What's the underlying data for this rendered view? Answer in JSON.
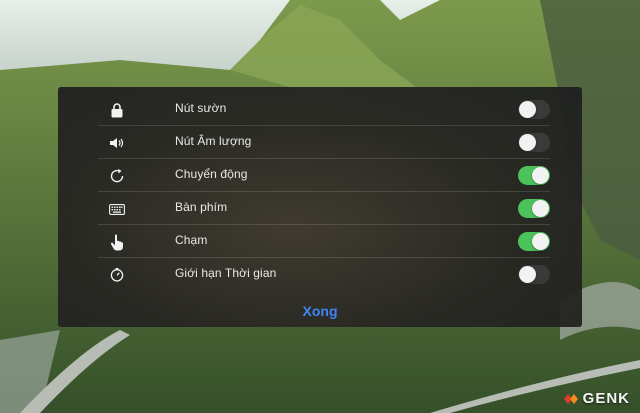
{
  "settings": {
    "items": [
      {
        "label": "Nút sườn",
        "icon": "lock-icon",
        "enabled": false
      },
      {
        "label": "Nút Âm lượng",
        "icon": "speaker-icon",
        "enabled": false
      },
      {
        "label": "Chuyển động",
        "icon": "rotate-icon",
        "enabled": true
      },
      {
        "label": "Bàn phím",
        "icon": "keyboard-icon",
        "enabled": true
      },
      {
        "label": "Chạm",
        "icon": "hand-pointer-icon",
        "enabled": true
      },
      {
        "label": "Giới hạn Thời gian",
        "icon": "timer-icon",
        "enabled": false
      }
    ],
    "done_label": "Xong"
  },
  "watermark": {
    "text": "GENK"
  },
  "colors": {
    "toggle_on": "#4cc25a",
    "toggle_off": "#3a3a3a",
    "done_text": "#3e86f5"
  }
}
